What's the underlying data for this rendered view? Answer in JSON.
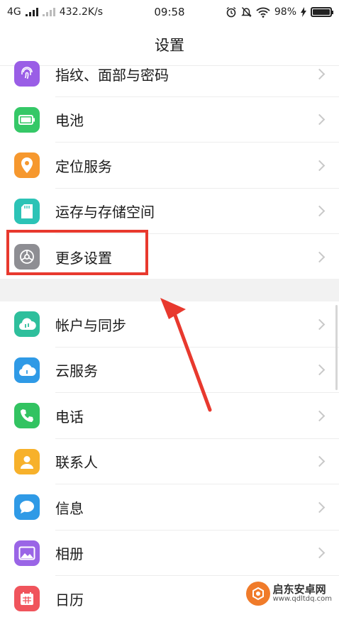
{
  "status": {
    "network": "4G",
    "speed": "432.2K/s",
    "time": "09:58",
    "battery": "98%",
    "battery_level": 0.98
  },
  "header": {
    "title": "设置"
  },
  "group1": [
    {
      "label": "指纹、面部与密码",
      "icon": "fingerprint-icon",
      "color": "#9a5ee6"
    },
    {
      "label": "电池",
      "icon": "battery-icon",
      "color": "#35c867"
    },
    {
      "label": "定位服务",
      "icon": "location-icon",
      "color": "#f6982e"
    },
    {
      "label": "运存与存储空间",
      "icon": "sdcard-icon",
      "color": "#2cc3b6"
    },
    {
      "label": "更多设置",
      "icon": "gear-icon",
      "color": "#8e8e93"
    }
  ],
  "group2": [
    {
      "label": "帐户与同步",
      "icon": "cloud-sync-icon",
      "color": "#2ebf9c"
    },
    {
      "label": "云服务",
      "icon": "cloud-icon",
      "color": "#2f9ae6"
    },
    {
      "label": "电话",
      "icon": "phone-icon",
      "color": "#32c361"
    },
    {
      "label": "联系人",
      "icon": "contact-icon",
      "color": "#f7b12b"
    },
    {
      "label": "信息",
      "icon": "message-icon",
      "color": "#2f9ae6"
    },
    {
      "label": "相册",
      "icon": "gallery-icon",
      "color": "#9a65e6"
    },
    {
      "label": "日历",
      "icon": "calendar-icon",
      "color": "#f0545c"
    }
  ],
  "colors": {
    "annotation": "#e8392e"
  },
  "watermark": {
    "title": "启东安卓网",
    "url": "www.qdltdq.com"
  }
}
